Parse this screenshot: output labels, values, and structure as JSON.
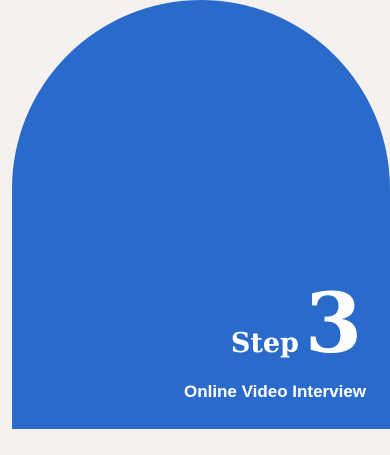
{
  "card": {
    "step_word": "Step",
    "step_number": "3",
    "subtitle": "Online Video Interview"
  },
  "colors": {
    "background": "#f4f1ef",
    "card": "#2a6acb",
    "text": "#ffffff"
  }
}
